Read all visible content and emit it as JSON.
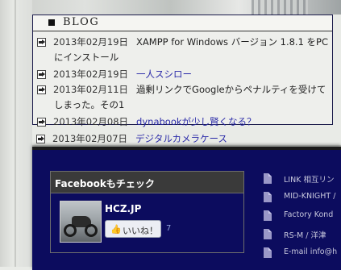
{
  "blog": {
    "title": "BLOG",
    "entries": [
      {
        "date": "2013年02月19日",
        "line1": "XAMPP for Windows  バージョン 1.8.1 をPC",
        "line2": "にインストール"
      },
      {
        "date": "2013年02月19日",
        "text": "一人スシロー"
      },
      {
        "date": "2013年02月11日",
        "line1": "過剰リンクでGoogleからペナルティを受けて",
        "line2": "しまった。その1"
      },
      {
        "date": "2013年02月08日",
        "text": "dynabookが少し賢くなる？"
      },
      {
        "date": "2013年02月07日",
        "text": "デジタルカメラケース"
      }
    ]
  },
  "facebook": {
    "title": "Facebookもチェック",
    "page_name": "HCZ.JP",
    "like_label": "いいね！",
    "like_count": "7"
  },
  "links": [
    {
      "label": "LINK  相互リン"
    },
    {
      "label": "MID-KNIGHT /"
    },
    {
      "label": "Factory Kond"
    },
    {
      "label": "RS-M / 洋津"
    },
    {
      "label": "E-mail info@h"
    }
  ],
  "colors": {
    "navy_background": "#0c0c5e",
    "link_blue": "#2a2aa8"
  }
}
